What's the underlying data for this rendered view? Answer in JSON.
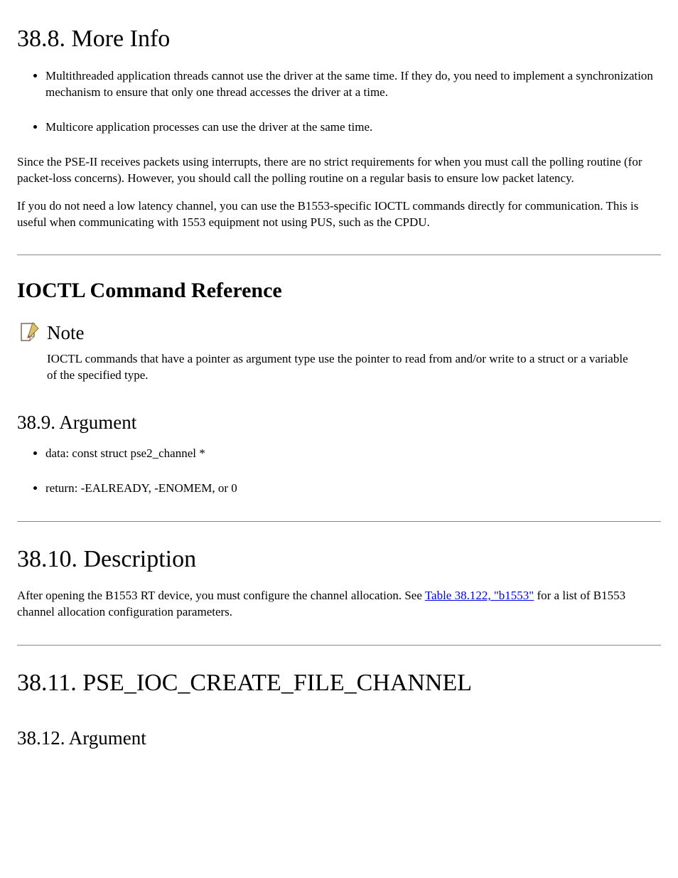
{
  "section1": {
    "heading": "38.8. More Info",
    "items": [
      "Multithreaded application threads cannot use the driver at the same time. If they do, you need to implement a synchronization mechanism to ensure that only one thread accesses the driver at a time.",
      "Multicore application processes can use the driver at the same time."
    ],
    "p1": "Since the PSE-II receives packets using interrupts, there are no strict requirements for when you must call the polling routine (for packet-loss concerns). However, you should call the polling routine on a regular basis to ensure low packet latency.",
    "p2": "If you do not need a low latency channel, you can use the B1553-specific IOCTL commands directly for communication. This is useful when communicating with 1553 equipment not using PUS, such as the CPDU."
  },
  "command": {
    "title": "IOCTL Command Reference",
    "note_label": "Note",
    "note_text": "IOCTL commands that have a pointer as argument type use the pointer to read from and/or write to a struct or a variable of the specified type."
  },
  "argument": {
    "heading": "38.9. Argument",
    "items": [
      "data: const struct pse2_channel *",
      "return: -EALREADY, -ENOMEM, or 0"
    ]
  },
  "description": {
    "heading": "38.10. Description",
    "text_before": "After opening the B1553 RT device, you must configure the channel allocation. See ",
    "link": "Table 38.122, \"b1553\"",
    "text_after": " for a list of B1553 channel allocation configuration parameters."
  },
  "section2": {
    "heading": "38.11. PSE_IOC_CREATE_FILE_CHANNEL",
    "argument_heading": "38.12. Argument"
  }
}
